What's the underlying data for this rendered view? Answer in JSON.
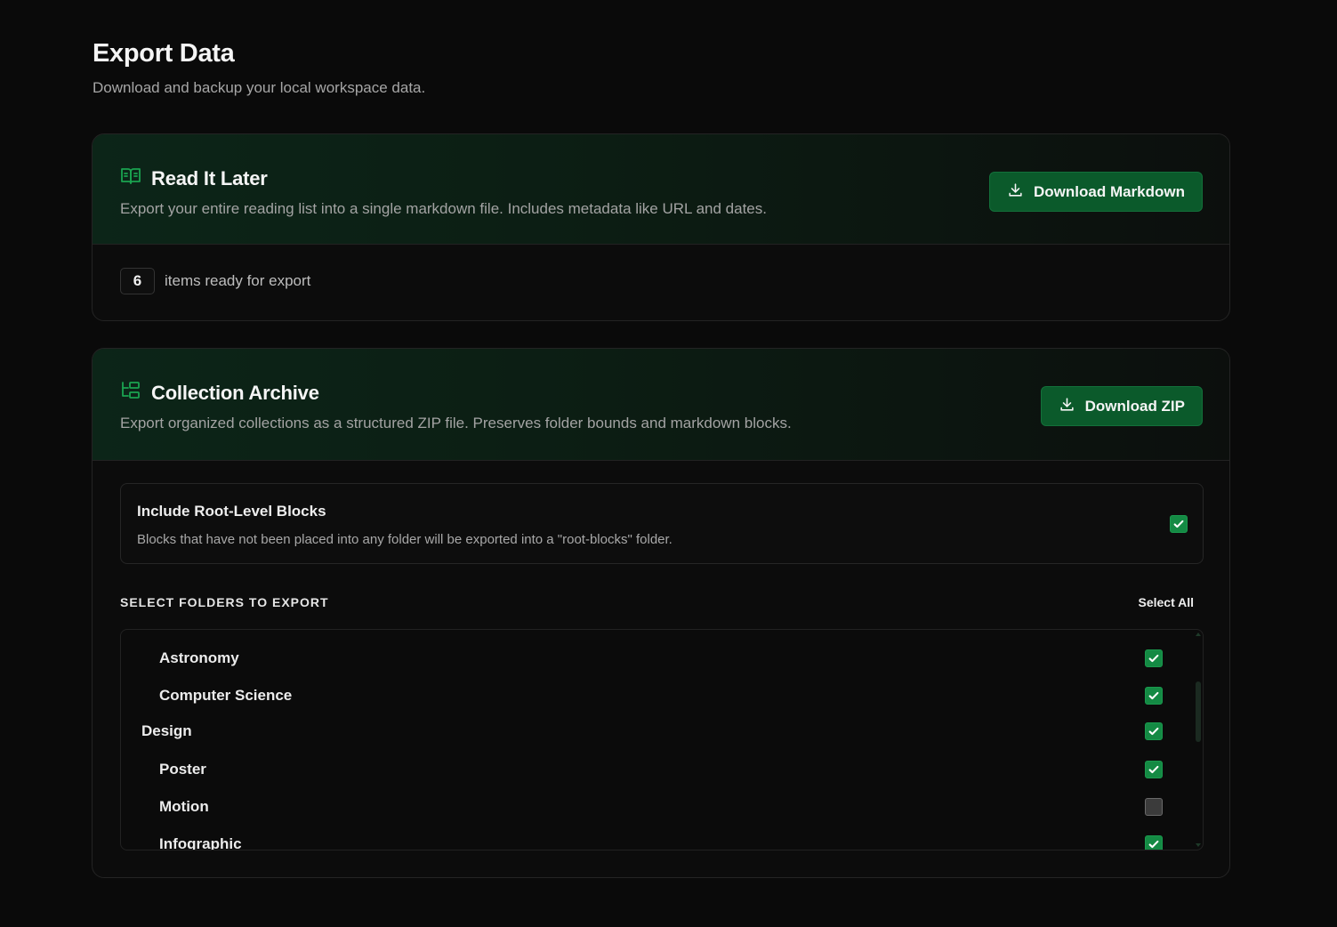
{
  "header": {
    "title": "Export Data",
    "subtitle": "Download and backup your local workspace data."
  },
  "read_it_later": {
    "icon": "book-open-icon",
    "title": "Read It Later",
    "description": "Export your entire reading list into a single markdown file. Includes metadata like URL and dates.",
    "button_label": "Download Markdown",
    "item_count": "6",
    "count_label": "items ready for export"
  },
  "collection_archive": {
    "icon": "folder-tree-icon",
    "title": "Collection Archive",
    "description": "Export organized collections as a structured ZIP file. Preserves folder bounds and markdown blocks.",
    "button_label": "Download ZIP",
    "root_blocks": {
      "title": "Include Root-Level Blocks",
      "description": "Blocks that have not been placed into any folder will be exported into a \"root-blocks\" folder.",
      "checked": true
    },
    "folders_label": "SELECT FOLDERS TO EXPORT",
    "select_all_label": "Select All",
    "folders": [
      {
        "name": "Astronomy",
        "depth": 1,
        "checked": true
      },
      {
        "name": "Computer Science",
        "depth": 1,
        "checked": true
      },
      {
        "name": "Design",
        "depth": 0,
        "checked": true
      },
      {
        "name": "Poster",
        "depth": 1,
        "checked": true
      },
      {
        "name": "Motion",
        "depth": 1,
        "checked": false
      },
      {
        "name": "Infographic",
        "depth": 1,
        "checked": true
      }
    ]
  },
  "colors": {
    "accent": "#148a44",
    "button_bg": "#0b5a2b",
    "background": "#0a0a0a"
  }
}
